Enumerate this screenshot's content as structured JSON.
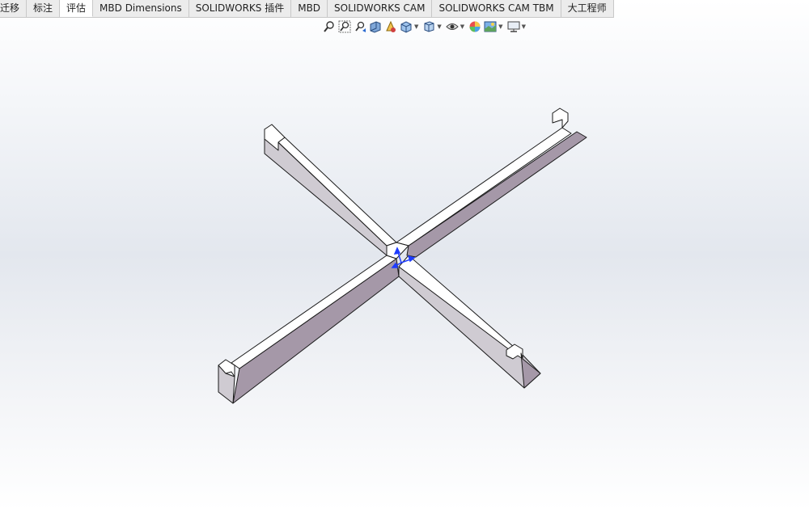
{
  "tabs": [
    {
      "label": "迁移",
      "active": false
    },
    {
      "label": "标注",
      "active": false
    },
    {
      "label": "评估",
      "active": true
    },
    {
      "label": "MBD Dimensions",
      "active": false
    },
    {
      "label": "SOLIDWORKS 插件",
      "active": false
    },
    {
      "label": "MBD",
      "active": false
    },
    {
      "label": "SOLIDWORKS CAM",
      "active": false
    },
    {
      "label": "SOLIDWORKS CAM TBM",
      "active": false
    },
    {
      "label": "大工程师",
      "active": false
    }
  ],
  "heads_up_toolbar": [
    "zoom-to-fit-icon",
    "zoom-to-area-icon",
    "previous-view-icon",
    "section-view-icon",
    "dynamic-annotation-icon",
    "view-orientation-icon",
    "display-style-icon",
    "hide-show-items-icon",
    "edit-appearance-icon",
    "apply-scene-icon",
    "view-settings-icon"
  ],
  "colors": {
    "top_face": "#ffffff",
    "side_face": "#a598a8",
    "end_face": "#cfcbd2",
    "edge": "#1a1a1a",
    "triad": "#1e3cff"
  }
}
